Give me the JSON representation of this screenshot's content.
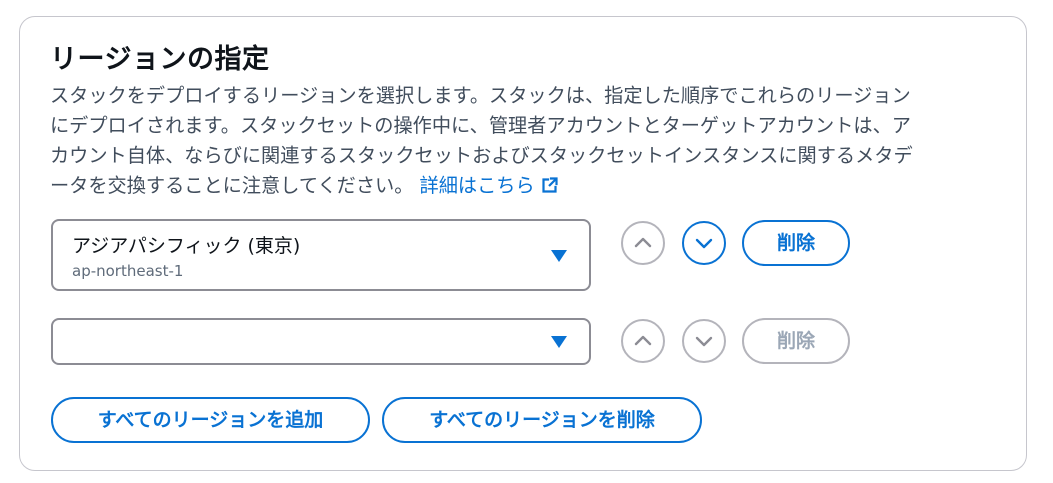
{
  "section": {
    "title": "リージョンの指定",
    "description_lines": [
      "スタックをデプロイするリージョンを選択します。スタックは、指定した順序でこれらのリージョン",
      "にデプロイされます。スタックセットの操作中に、管理者アカウントとターゲットアカウントは、ア",
      "カウント自体、ならびに関連するスタックセットおよびスタックセットインスタンスに関するメタデ",
      "ータを交換することに注意してください。"
    ],
    "learn_more_link": "詳細はこちら",
    "link_icon": "external-link-icon"
  },
  "regions": [
    {
      "label": "アジアパシフィック (東京)",
      "code": "ap-northeast-1",
      "move_up_icon": "chevron-up-icon",
      "move_down_icon": "chevron-down-icon",
      "move_up_enabled": false,
      "move_down_enabled": true,
      "remove_label": "削除",
      "remove_enabled": true
    },
    {
      "label": "",
      "code": "",
      "move_up_icon": "chevron-up-icon",
      "move_down_icon": "chevron-down-icon",
      "move_up_enabled": false,
      "move_down_enabled": false,
      "remove_label": "削除",
      "remove_enabled": false
    }
  ],
  "actions": {
    "add_all_label": "すべてのリージョンを追加",
    "remove_all_label": "すべてのリージョンを削除"
  },
  "colors": {
    "accent": "#0972d3",
    "disabled_border": "#b4b4bb",
    "disabled_text": "#9ba7b6",
    "select_border": "#8c8c94",
    "panel_border": "#c6c6cd"
  }
}
